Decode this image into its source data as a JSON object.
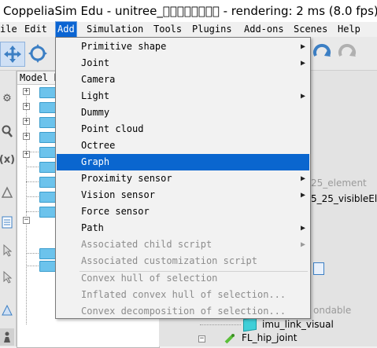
{
  "window": {
    "title": "CoppeliaSim Edu - unitree_\u0000\u0000\u0000\u0000\u0000\u0000\u0000\u0000 - rendering: 2 ms (8.0 fps) - S"
  },
  "menubar": {
    "items": [
      "ile",
      "Edit",
      "Add",
      "Simulation",
      "Tools",
      "Plugins",
      "Add-ons",
      "Scenes",
      "Help"
    ],
    "active": "Add"
  },
  "hierarchy": {
    "header": "Model b"
  },
  "scene": {
    "labels": [
      "25_element",
      "5_25_visibleEl",
      "ondable",
      "imu_link_visual",
      "FL_hip_joint"
    ]
  },
  "add_menu": {
    "items": [
      {
        "label": "Primitive shape",
        "submenu": true,
        "enabled": true
      },
      {
        "label": "Joint",
        "submenu": true,
        "enabled": true
      },
      {
        "label": "Camera",
        "submenu": false,
        "enabled": true
      },
      {
        "label": "Light",
        "submenu": true,
        "enabled": true
      },
      {
        "label": "Dummy",
        "submenu": false,
        "enabled": true
      },
      {
        "label": "Point cloud",
        "submenu": false,
        "enabled": true
      },
      {
        "label": "Octree",
        "submenu": false,
        "enabled": true
      },
      {
        "label": "Graph",
        "submenu": false,
        "enabled": true,
        "highlighted": true
      },
      {
        "label": "Proximity sensor",
        "submenu": true,
        "enabled": true
      },
      {
        "label": "Vision sensor",
        "submenu": true,
        "enabled": true
      },
      {
        "label": "Force sensor",
        "submenu": false,
        "enabled": true
      },
      {
        "label": "Path",
        "submenu": true,
        "enabled": true
      },
      {
        "label": "Associated child script",
        "submenu": true,
        "enabled": false
      },
      {
        "label": "Associated customization script",
        "submenu": false,
        "enabled": false
      },
      {
        "label": "Convex hull of selection",
        "submenu": false,
        "enabled": false
      },
      {
        "label": "Inflated convex hull of selection...",
        "submenu": false,
        "enabled": false
      },
      {
        "label": "Convex decomposition of selection...",
        "submenu": false,
        "enabled": false
      }
    ]
  },
  "colors": {
    "highlight": "#0a66cf",
    "menubar_active": "#0a64d2",
    "folder": "#6cc3ec",
    "disabled_text": "#8c8c8c"
  }
}
